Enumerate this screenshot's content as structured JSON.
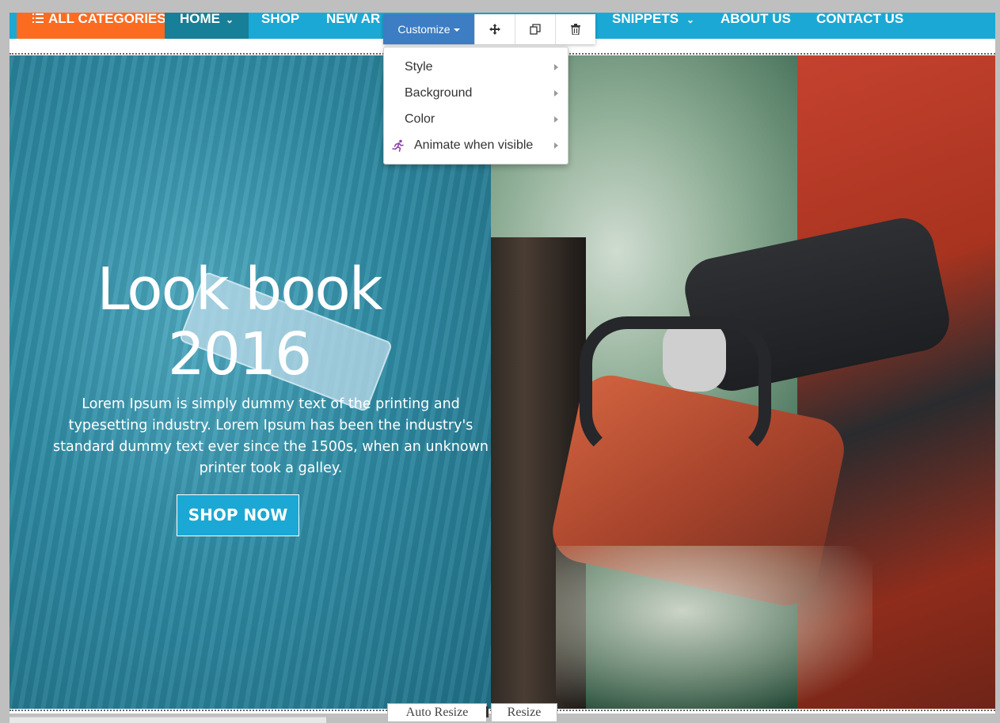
{
  "nav": {
    "all_categories": "ALL CATEGORIES",
    "home": "HOME",
    "shop": "SHOP",
    "new_arrivals": "NEW AR",
    "snippets": "SNIPPETS",
    "about_us": "ABOUT US",
    "contact_us": "CONTACT US"
  },
  "toolbar": {
    "customize": "Customize"
  },
  "menu": {
    "items": [
      {
        "label": "Style"
      },
      {
        "label": "Background"
      },
      {
        "label": "Color"
      },
      {
        "label": "Animate when visible"
      }
    ]
  },
  "hero": {
    "title_line1": "Look book",
    "title_line2": "2016",
    "text": "Lorem Ipsum is simply dummy text of the printing and typesetting industry. Lorem Ipsum has been the industry's standard dummy text ever since the 1500s, when an unknown printer took a galley.",
    "cta": "SHOP NOW"
  },
  "resize": {
    "auto": "Auto Resize",
    "manual": "Resize"
  },
  "colors": {
    "nav_bg": "#1ba8d4",
    "categories_bg": "#fb6c21",
    "home_bg": "#177f97",
    "customize_bg": "#3c7dc4",
    "overlay": "#2f8ba3"
  }
}
